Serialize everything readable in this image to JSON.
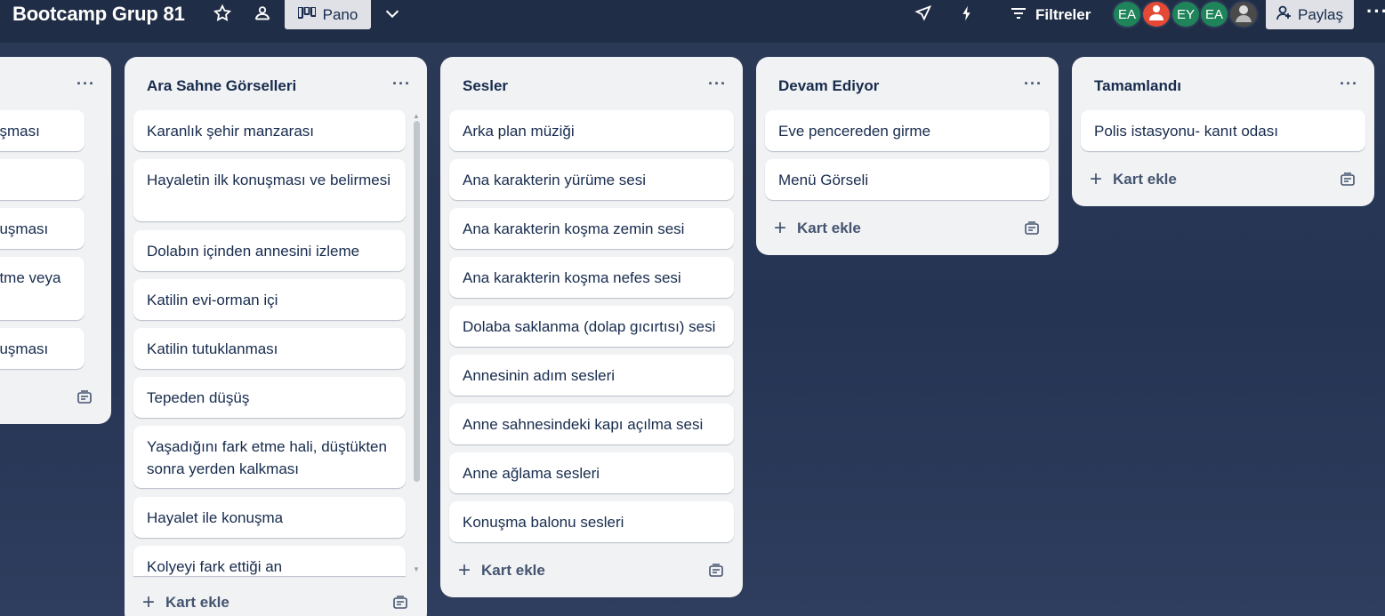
{
  "header": {
    "board_title": "Bootcamp Grup 81",
    "view_label": "Pano",
    "filter_label": "Filtreler",
    "share_label": "Paylaş",
    "avatars": [
      {
        "initials": "EA",
        "color": "#1f845a"
      },
      {
        "initials": "",
        "color": "#e34935"
      },
      {
        "initials": "EY",
        "color": "#1f845a"
      },
      {
        "initials": "EA",
        "color": "#1f845a"
      },
      {
        "initials": "",
        "color": "#4a4a4a"
      }
    ]
  },
  "lists": [
    {
      "title": "",
      "cards": [
        "uşması",
        "",
        "nuşması",
        "etme veya",
        "nuşması"
      ],
      "add_label": ""
    },
    {
      "title": "Ara Sahne Görselleri",
      "cards": [
        "Karanlık şehir manzarası",
        "Hayaletin ilk konuşması ve belirmesi",
        "Dolabın içinden annesini izleme",
        "Katilin evi-orman içi",
        "Katilin tutuklanması",
        "Tepeden düşüş",
        "Yaşadığını fark etme hali, düştükten sonra yerden kalkması",
        "Hayalet ile konuşma",
        "Kolyeyi fark ettiği an"
      ],
      "add_label": "Kart ekle"
    },
    {
      "title": "Sesler",
      "cards": [
        "Arka plan müziği",
        "Ana karakterin yürüme sesi",
        "Ana karakterin koşma zemin sesi",
        "Ana karakterin koşma nefes sesi",
        "Dolaba saklanma (dolap gıcırtısı) sesi",
        "Annesinin adım sesleri",
        "Anne sahnesindeki kapı açılma sesi",
        "Anne ağlama sesleri",
        "Konuşma balonu sesleri"
      ],
      "add_label": "Kart ekle"
    },
    {
      "title": "Devam Ediyor",
      "cards": [
        "Eve pencereden girme",
        "Menü Görseli"
      ],
      "add_label": "Kart ekle"
    },
    {
      "title": "Tamamlandı",
      "cards": [
        "Polis istasyonu- kanıt odası"
      ],
      "add_label": "Kart ekle"
    }
  ],
  "icons": {
    "star": "star-icon",
    "visibility": "team-visibility-icon",
    "board": "board-view-icon",
    "chevron": "chevron-down-icon",
    "powerup": "rocket-icon",
    "automation": "lightning-icon",
    "filter": "filter-icon",
    "share": "add-member-icon",
    "template": "card-template-icon"
  }
}
